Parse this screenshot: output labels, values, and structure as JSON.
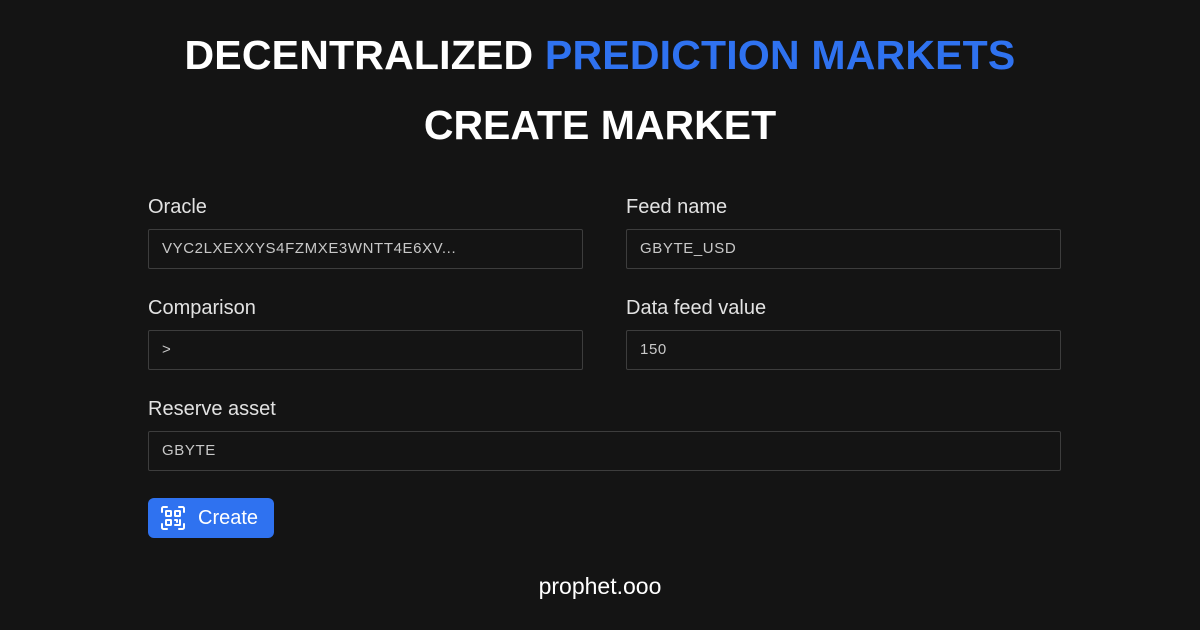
{
  "header": {
    "title_part1": "DECENTRALIZED",
    "title_part2": "PREDICTION MARKETS",
    "subtitle": "CREATE MARKET"
  },
  "form": {
    "oracle": {
      "label": "Oracle",
      "value": "VYC2LXEXXYS4FZMXE3WNTT4E6XV..."
    },
    "feed_name": {
      "label": "Feed name",
      "value": "GBYTE_USD"
    },
    "comparison": {
      "label": "Comparison",
      "value": ">"
    },
    "data_feed_value": {
      "label": "Data feed value",
      "value": "150"
    },
    "reserve_asset": {
      "label": "Reserve asset",
      "value": "GBYTE"
    }
  },
  "create_button": {
    "label": "Create",
    "icon": "qr-code-icon"
  },
  "footer": {
    "site": "prophet.ooo"
  },
  "colors": {
    "background": "#141414",
    "accent": "#2f72f0",
    "text": "#ffffff",
    "input_border": "#3d3d3d"
  }
}
